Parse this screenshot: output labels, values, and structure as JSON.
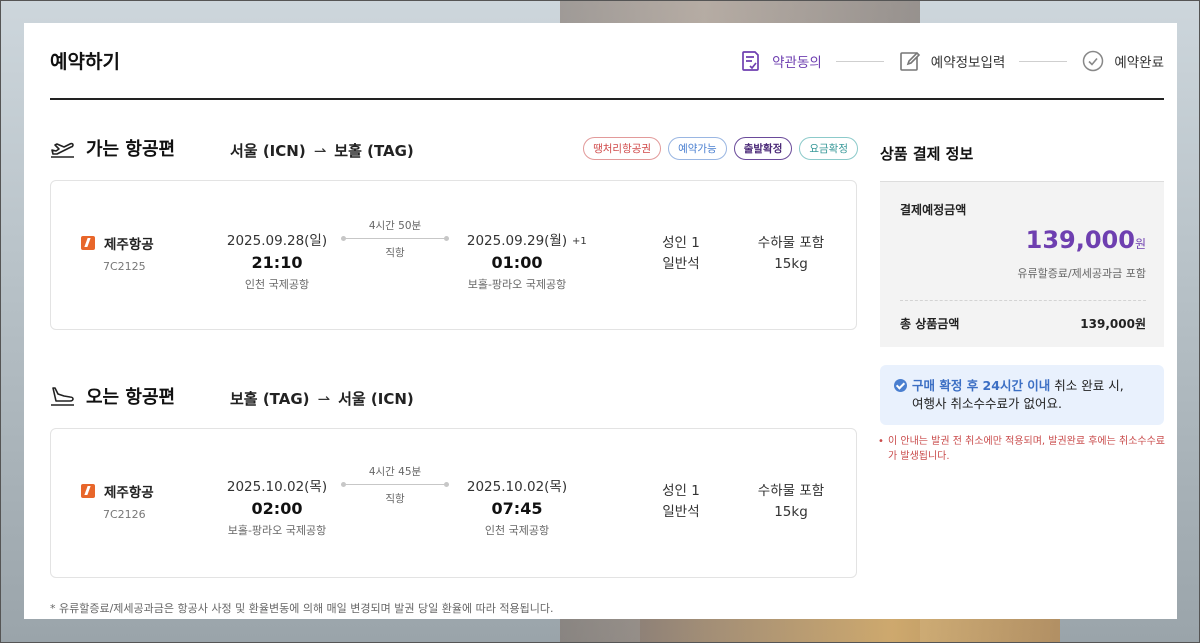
{
  "page_title": "예약하기",
  "steps": [
    {
      "label": "약관동의",
      "icon": "terms-check-icon",
      "active": true
    },
    {
      "label": "예약정보입력",
      "icon": "edit-form-icon",
      "active": false
    },
    {
      "label": "예약완료",
      "icon": "check-circle-icon",
      "active": false
    }
  ],
  "outbound": {
    "title": "가는 항공편",
    "route_from": "서울 (ICN)",
    "route_arrow": "⇀",
    "route_to": "보홀 (TAG)",
    "badges": [
      "땡처리항공권",
      "예약가능",
      "출발확정",
      "요금확정"
    ],
    "airline": "제주항공",
    "flight_code": "7C2125",
    "dep_date": "2025.09.28(일)",
    "dep_time": "21:10",
    "dep_airport": "인천 국제공항",
    "duration": "4시간 50분",
    "direct": "직항",
    "arr_date": "2025.09.29(월)",
    "arr_plus": "+1",
    "arr_time": "01:00",
    "arr_airport": "보홀-팡라오 국제공항",
    "pax": "성인 1",
    "cabin": "일반석",
    "baggage_label": "수하물 포함",
    "baggage_weight": "15kg"
  },
  "inbound": {
    "title": "오는 항공편",
    "route_from": "보홀 (TAG)",
    "route_arrow": "⇀",
    "route_to": "서울 (ICN)",
    "airline": "제주항공",
    "flight_code": "7C2126",
    "dep_date": "2025.10.02(목)",
    "dep_time": "02:00",
    "dep_airport": "보홀-팡라오 국제공항",
    "duration": "4시간 45분",
    "direct": "직항",
    "arr_date": "2025.10.02(목)",
    "arr_time": "07:45",
    "arr_airport": "인천 국제공항",
    "pax": "성인 1",
    "cabin": "일반석",
    "baggage_label": "수하물 포함",
    "baggage_weight": "15kg"
  },
  "payment": {
    "title": "상품 결제 정보",
    "expected_label": "결제예정금액",
    "expected_amount": "139,000",
    "currency": "원",
    "includes_note": "유류할증료/제세공과금 포함",
    "total_label": "총 상품금액",
    "total_value": "139,000원"
  },
  "notice": {
    "highlight": "구매 확정 후 24시간 이내",
    "rest_line1": " 취소 완료 시,",
    "line2": "여행사 취소수수료가 없어요."
  },
  "warning": {
    "bullet": "•",
    "text": "이 안내는 발권 전 취소에만 적용되며, 발권완료 후에는 취소수수료가 발생됩니다."
  },
  "footnote": "*  유류할증료/제세공과금은 항공사 사정 및 환율변동에 의해 매일 변경되며 발권 당일 환율에 따라 적용됩니다.",
  "colors": {
    "accent": "#6e3fb0",
    "notice_bg": "#e9f1fd",
    "warning": "#c94b4b"
  }
}
